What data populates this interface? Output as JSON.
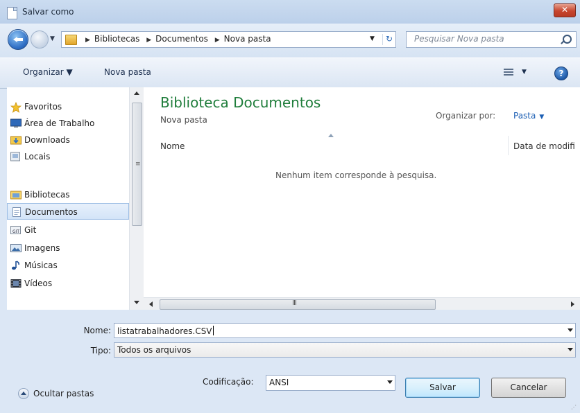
{
  "window": {
    "title": "Salvar como",
    "close_label": "✕"
  },
  "address": {
    "crumbs": [
      "Bibliotecas",
      "Documentos",
      "Nova pasta"
    ],
    "search_placeholder": "Pesquisar Nova pasta"
  },
  "toolbar": {
    "organize": "Organizar ▼",
    "new_folder": "Nova pasta"
  },
  "nav": {
    "items": [
      {
        "label": "Favoritos",
        "icon": "star-icon"
      },
      {
        "label": "Área de Trabalho",
        "icon": "desktop-icon"
      },
      {
        "label": "Downloads",
        "icon": "downloads-folder-icon"
      },
      {
        "label": "Locais",
        "icon": "recent-places-icon"
      },
      {
        "label": "Bibliotecas",
        "icon": "libraries-icon"
      },
      {
        "label": "Documentos",
        "icon": "documents-icon"
      },
      {
        "label": "Git",
        "icon": "git-icon"
      },
      {
        "label": "Imagens",
        "icon": "pictures-icon"
      },
      {
        "label": "Músicas",
        "icon": "music-icon"
      },
      {
        "label": "Vídeos",
        "icon": "videos-icon"
      }
    ],
    "selected": "Documentos"
  },
  "main": {
    "library_title": "Biblioteca Documentos",
    "library_subtitle": "Nova pasta",
    "arrange_label": "Organizar por:",
    "arrange_value": "Pasta",
    "columns": [
      "Nome",
      "Data de modifi"
    ],
    "empty_message": "Nenhum item corresponde à pesquisa."
  },
  "bottom": {
    "name_label": "Nome:",
    "name_value": "listatrabalhadores.CSV",
    "type_label": "Tipo:",
    "type_value": "Todos os arquivos",
    "hide_folders": "Ocultar pastas",
    "encoding_label": "Codificação:",
    "encoding_value": "ANSI",
    "save": "Salvar",
    "cancel": "Cancelar"
  },
  "colors": {
    "library_title": "#1f7d3b",
    "link": "#1c5fb4",
    "window_bg": "#dce7f5"
  }
}
